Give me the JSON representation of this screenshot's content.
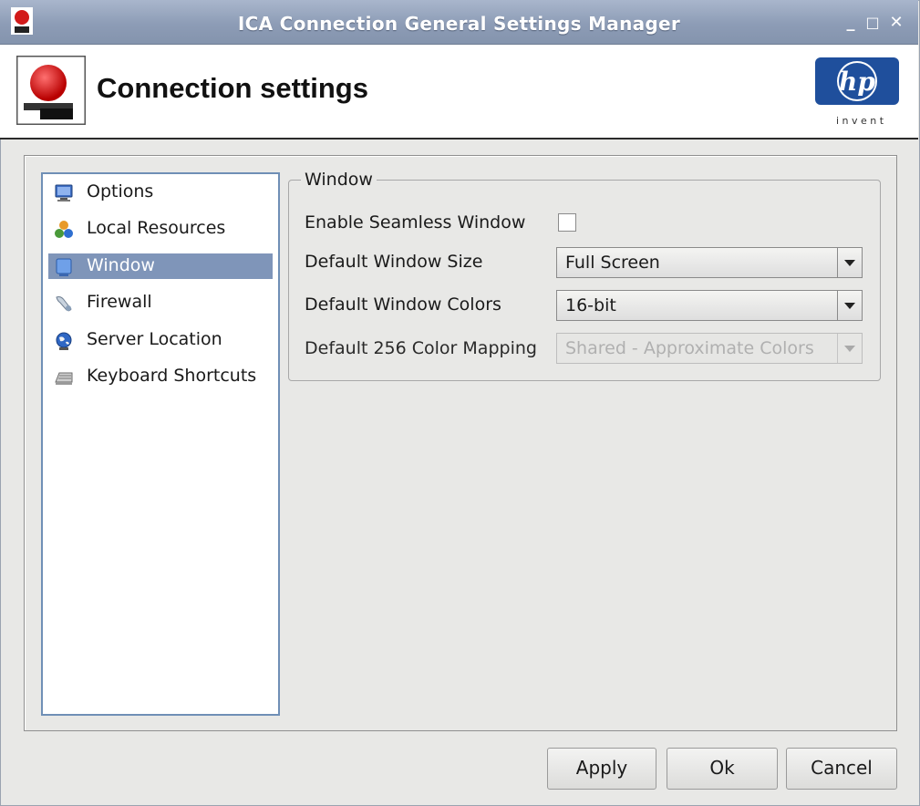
{
  "window": {
    "title": "ICA Connection General Settings Manager",
    "buttons": {
      "minimize": "_",
      "maximize": "□",
      "close": "✕"
    }
  },
  "header": {
    "title": "Connection settings",
    "logo": {
      "text": "hp",
      "tagline": "i n v e n t"
    }
  },
  "nav": {
    "items": [
      {
        "label": "Options",
        "icon": "monitor-icon",
        "selected": false
      },
      {
        "label": "Local Resources",
        "icon": "shapes-icon",
        "selected": false
      },
      {
        "label": "Window",
        "icon": "window-icon",
        "selected": true
      },
      {
        "label": "Firewall",
        "icon": "firewall-icon",
        "selected": false
      },
      {
        "label": "Server Location",
        "icon": "globe-icon",
        "selected": false
      },
      {
        "label": "Keyboard Shortcuts",
        "icon": "keyboard-icon",
        "selected": false
      }
    ]
  },
  "window_group": {
    "title": "Window",
    "seamless": {
      "label": "Enable Seamless Window",
      "checked": false
    },
    "size": {
      "label": "Default Window Size",
      "value": "Full Screen"
    },
    "colors": {
      "label": "Default Window Colors",
      "value": "16-bit"
    },
    "mapping": {
      "label": "Default 256 Color Mapping",
      "value": "Shared - Approximate Colors",
      "disabled": true
    }
  },
  "footer": {
    "apply": "Apply",
    "ok": "Ok",
    "cancel": "Cancel"
  },
  "colors": {
    "titlebar": "#8d9cb6",
    "selection": "#7f95b9",
    "hp_blue": "#1f4f9c"
  }
}
